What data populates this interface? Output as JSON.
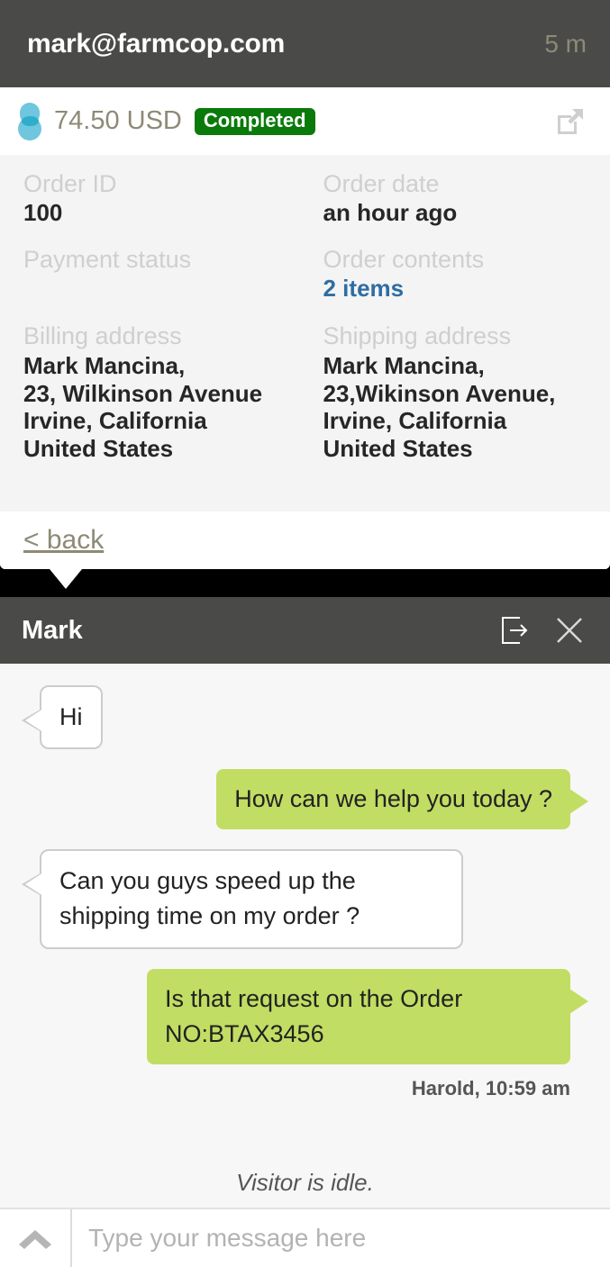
{
  "order_card": {
    "header": {
      "email": "mark@farmcop.com",
      "time_ago": "5 m"
    },
    "summary": {
      "payment_logo": "paypal-logo-icon",
      "amount": "74.50 USD",
      "status_badge": "Completed",
      "status_color": "#0a7a0a",
      "external_link_icon": "external-link-icon"
    },
    "details": {
      "order_id_label": "Order ID",
      "order_id_value": "100",
      "order_date_label": "Order date",
      "order_date_value": "an hour ago",
      "payment_status_label": "Payment status",
      "payment_status_value": "",
      "order_contents_label": "Order contents",
      "order_contents_value": "2 items",
      "order_contents_color": "#2e6da4",
      "billing_address_label": "Billing address",
      "billing_address_lines": [
        "Mark Mancina,",
        "23, Wilkinson Avenue",
        "Irvine, California",
        "United States"
      ],
      "shipping_address_label": "Shipping address",
      "shipping_address_lines": [
        "Mark Mancina,",
        "23,Wikinson Avenue,",
        "Irvine, California",
        "United States"
      ]
    },
    "footer": {
      "back_label": "< back"
    }
  },
  "chat": {
    "header": {
      "title": "Mark",
      "exit_icon": "exit-arrow-icon",
      "close_icon": "close-icon"
    },
    "messages": [
      {
        "text": "Hi",
        "direction": "in"
      },
      {
        "text": "How can we help you today ?",
        "direction": "out"
      },
      {
        "text": "Can you guys speed up the shipping time on my order ?",
        "direction": "in"
      },
      {
        "text": "Is that request on the Order NO:BTAX3456",
        "direction": "out"
      }
    ],
    "message_meta": "Harold, 10:59 am",
    "status_text": "Visitor is idle.",
    "input": {
      "placeholder": "Type your message here",
      "value": "",
      "chevron_icon": "chevron-up-icon"
    },
    "bubble_out_color": "#c2dd63"
  }
}
